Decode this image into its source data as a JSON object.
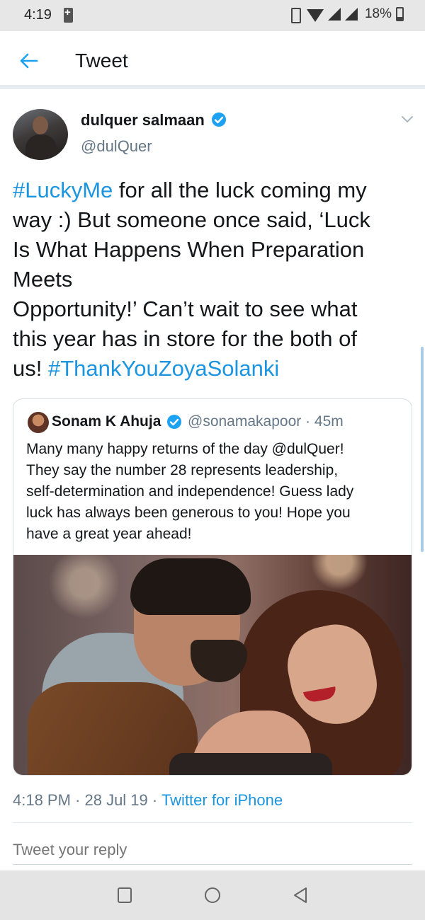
{
  "status_bar": {
    "time": "4:19",
    "battery": "18%"
  },
  "header": {
    "title": "Tweet"
  },
  "tweet": {
    "author_name": "dulquer salmaan",
    "author_handle": "@dulQuer",
    "text_lines": [
      [
        {
          "t": "#LuckyMe",
          "tag": true
        },
        {
          "t": " for all the luck coming my",
          "tag": false
        }
      ],
      [
        {
          "t": "way :) But someone once said, ‘Luck",
          "tag": false
        }
      ],
      [
        {
          "t": "Is What Happens When Preparation",
          "tag": false
        }
      ],
      [
        {
          "t": "Meets",
          "tag": false
        }
      ],
      [
        {
          "t": "Opportunity!’ Can’t wait to see what",
          "tag": false
        }
      ],
      [
        {
          "t": "this year has in store for the both of",
          "tag": false
        }
      ],
      [
        {
          "t": "us! ",
          "tag": false
        },
        {
          "t": "#ThankYouZoyaSolanki",
          "tag": true
        }
      ]
    ],
    "timestamp": "4:18 PM · 28 Jul 19 · ",
    "source": "Twitter for iPhone"
  },
  "quoted_tweet": {
    "author_name": "Sonam K Ahuja",
    "author_handle_time": "@sonamakapoor · 45m",
    "text_lines": [
      "Many many happy returns of the day @dulQuer!",
      "They say the number 28 represents leadership,",
      "self-determination and independence! Guess lady",
      "luck has always been generous to you! Hope you",
      "have a great year ahead!"
    ]
  },
  "reply": {
    "placeholder": "Tweet your reply"
  },
  "colors": {
    "link_blue": "#1b95e0",
    "verified_blue": "#1da1f2",
    "muted_gray": "#657786"
  },
  "icons": [
    "charging-icon",
    "vibrate-icon",
    "wifi-icon",
    "signal-icon",
    "battery-icon",
    "back-arrow-icon",
    "verified-badge-icon",
    "chevron-down-icon",
    "nav-recents-icon",
    "nav-home-icon",
    "nav-back-icon"
  ]
}
